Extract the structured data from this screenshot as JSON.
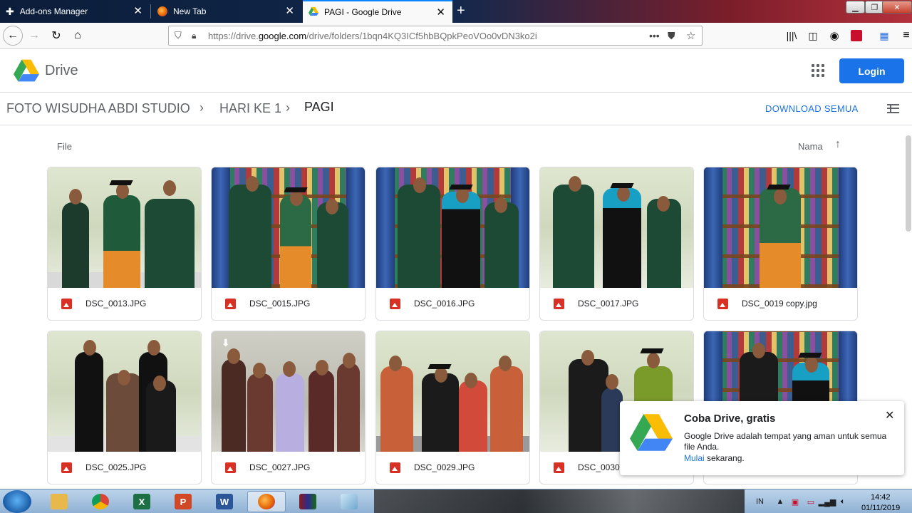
{
  "browser": {
    "tabs": [
      {
        "title": "Add-ons Manager",
        "icon": "puzzle-icon",
        "active": false
      },
      {
        "title": "New Tab",
        "icon": "firefox-icon",
        "active": false
      },
      {
        "title": "PAGI - Google Drive",
        "icon": "drive-icon",
        "active": true
      }
    ],
    "url_prefix": "https://drive.",
    "url_domain": "google.com",
    "url_path": "/drive/folders/1bqn4KQ3ICf5hbBQpkPeoVOo0vDN3ko2i"
  },
  "drive": {
    "wordmark": "Drive",
    "login_label": "Login",
    "breadcrumb": [
      "FOTO WISUDHA ABDI STUDIO",
      "HARI KE 1",
      "PAGI"
    ],
    "download_all_label": "DOWNLOAD SEMUA",
    "section_label": "File",
    "sort_label": "Nama",
    "files": [
      {
        "name": "DSC_0013.JPG"
      },
      {
        "name": "DSC_0015.JPG"
      },
      {
        "name": "DSC_0016.JPG"
      },
      {
        "name": "DSC_0017.JPG"
      },
      {
        "name": "DSC_0019 copy.jpg"
      },
      {
        "name": "DSC_0025.JPG"
      },
      {
        "name": "DSC_0027.JPG"
      },
      {
        "name": "DSC_0029.JPG"
      },
      {
        "name": "DSC_0030"
      },
      {
        "name": ""
      }
    ]
  },
  "promo": {
    "title": "Coba Drive, gratis",
    "body": "Google Drive adalah tempat yang aman untuk semua file Anda.",
    "link": "Mulai",
    "suffix": "sekarang."
  },
  "taskbar": {
    "language": "IN",
    "time": "14:42",
    "date": "01/11/2019"
  },
  "colors": {
    "accent": "#1a73e8",
    "file_icon": "#d93025"
  }
}
